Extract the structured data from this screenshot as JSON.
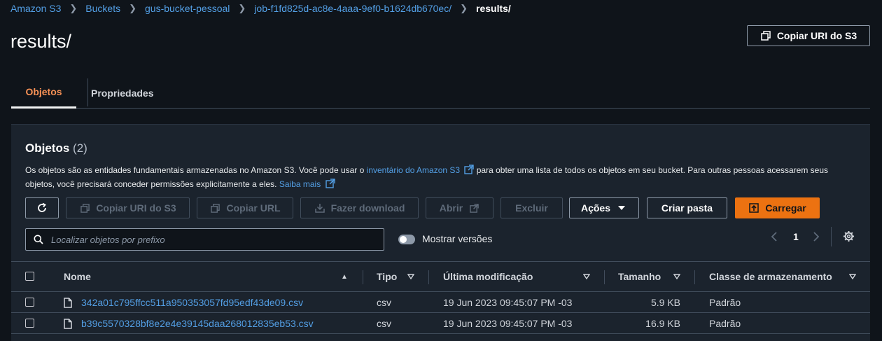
{
  "breadcrumb": {
    "items": [
      "Amazon S3",
      "Buckets",
      "gus-bucket-pessoal",
      "job-f1fd825d-ac8e-4aaa-9ef0-b1624db670ec/"
    ],
    "current": "results/"
  },
  "page": {
    "title": "results/",
    "copy_uri_button": "Copiar URI do S3"
  },
  "tabs": [
    {
      "label": "Objetos",
      "active": true
    },
    {
      "label": "Propriedades",
      "active": false
    }
  ],
  "objects_panel": {
    "title": "Objetos",
    "count": "(2)",
    "desc_part1": "Os objetos são as entidades fundamentais armazenadas no Amazon S3. Você pode usar o ",
    "desc_link1": "inventário do Amazon S3",
    "desc_part2": " para obter uma lista de todos os objetos em seu bucket. Para outras pessoas acessarem seus objetos, você precisará conceder permissões explicitamente a eles. ",
    "desc_link2": "Saiba mais"
  },
  "toolbar": {
    "copy_uri": "Copiar URI do S3",
    "copy_url": "Copiar URL",
    "download": "Fazer download",
    "open": "Abrir",
    "delete": "Excluir",
    "actions": "Ações",
    "create_folder": "Criar pasta",
    "upload": "Carregar"
  },
  "search": {
    "placeholder": "Localizar objetos por prefixo"
  },
  "versions_toggle": {
    "label": "Mostrar versões",
    "on": false
  },
  "pagination": {
    "page": "1"
  },
  "table": {
    "headers": {
      "name": "Nome",
      "type": "Tipo",
      "modified": "Última modificação",
      "size": "Tamanho",
      "storage_class": "Classe de armazenamento"
    },
    "rows": [
      {
        "name": "342a01c795ffcc511a950353057fd95edf43de09.csv",
        "type": "csv",
        "modified": "19 Jun 2023 09:45:07 PM -03",
        "size": "5.9 KB",
        "storage_class": "Padrão"
      },
      {
        "name": "b39c5570328bf8e2e4e39145daa268012835eb53.csv",
        "type": "csv",
        "modified": "19 Jun 2023 09:45:07 PM -03",
        "size": "16.9 KB",
        "storage_class": "Padrão"
      }
    ]
  },
  "colors": {
    "background": "#0f141a",
    "panel": "#1b232d",
    "link": "#539fe5",
    "primary": "#ec7211",
    "active_tab": "#f89256"
  }
}
